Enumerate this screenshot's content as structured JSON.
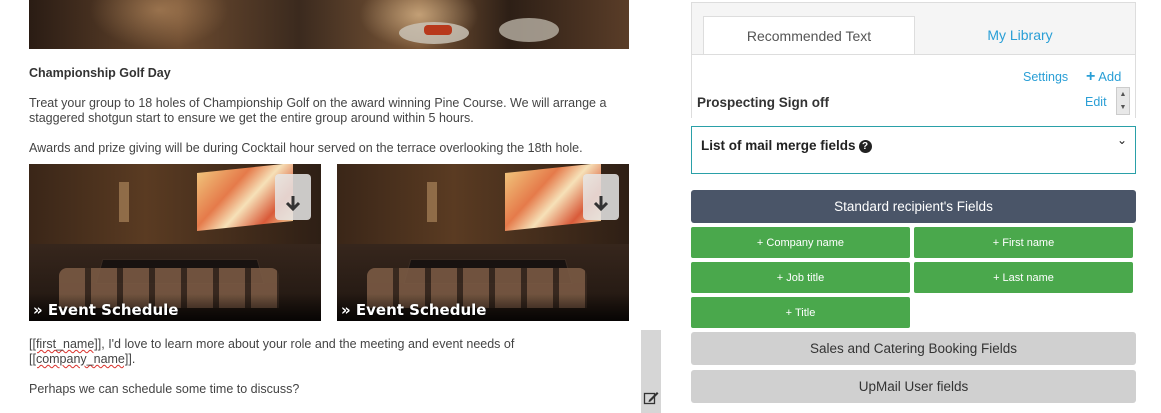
{
  "email": {
    "heading": "Championship Golf Day",
    "paragraph_1": "Treat your group to 18 holes of Championship Golf on the award winning Pine Course. We will arrange a staggered shotgun start to ensure we get the entire group around within 5 hours.",
    "paragraph_2": "Awards and prize giving will be during Cocktail hour served on the terrace overlooking the 18th hole.",
    "image_captions": [
      "» Event Schedule",
      "» Event Schedule"
    ],
    "merge_line_token_1": "[[first_name]]",
    "merge_line_text_1": ", I'd love to learn more about your role and the meeting and event needs of",
    "merge_line_token_2": "[[company_name]]",
    "merge_line_text_2": ".",
    "paragraph_4": "Perhaps we can schedule some time to discuss?"
  },
  "panel": {
    "tabs": {
      "recommended": "Recommended Text",
      "library": "My Library"
    },
    "settings_label": "Settings",
    "add_label": "Add",
    "signoff_label": "Prospecting Sign off",
    "edit_label": "Edit"
  },
  "merge_fields": {
    "title": "List of mail merge fields",
    "standard_header": "Standard recipient's Fields",
    "buttons": [
      "+ Company name",
      "+ First name",
      "+ Job title",
      "+ Last name",
      "+ Title"
    ],
    "sales_catering": "Sales and Catering Booking Fields",
    "upmail_user": "UpMail User fields"
  },
  "colors": {
    "accent_link": "#2a9fd6",
    "field_button": "#4aa84c",
    "header_dark": "#4a5568",
    "section_grey": "#d0d0d0",
    "merge_box_border": "#2aa0a8"
  }
}
